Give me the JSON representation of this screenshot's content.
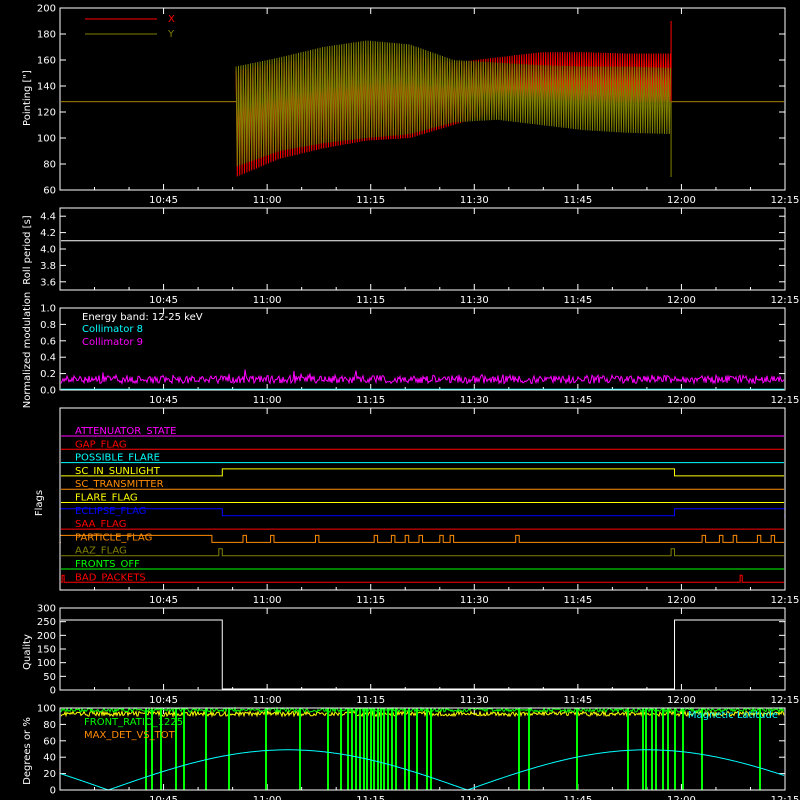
{
  "time_axis": {
    "ticks": [
      "10:45",
      "11:00",
      "11:15",
      "11:30",
      "11:45",
      "12:00",
      "12:15"
    ],
    "range_minutes": [
      630,
      735
    ],
    "tick_minutes": [
      645,
      660,
      675,
      690,
      705,
      720,
      735
    ]
  },
  "chart_data": [
    {
      "type": "line",
      "ylabel": "Pointing [\"]",
      "ylim": [
        60,
        200
      ],
      "yticks": [
        "60",
        "80",
        "100",
        "120",
        "140",
        "160",
        "180",
        "200"
      ],
      "legend_position": "top-left",
      "series": [
        {
          "name": "X",
          "color": "#ff0000",
          "baseline": 128,
          "active_start_min": 655.5,
          "active_end_min": 718.5,
          "envelope_min": [
            70,
            84,
            92,
            98,
            100,
            110,
            120,
            125,
            127,
            127,
            128
          ],
          "envelope_max": [
            152,
            158,
            162,
            165,
            164,
            158,
            162,
            166,
            166,
            165,
            165
          ]
        },
        {
          "name": "Y",
          "color": "#808000",
          "baseline": 128,
          "active_start_min": 655.5,
          "active_end_min": 718.5,
          "envelope_min": [
            78,
            90,
            96,
            100,
            103,
            112,
            114,
            110,
            106,
            104,
            103
          ],
          "envelope_max": [
            155,
            162,
            170,
            175,
            172,
            160,
            158,
            156,
            155,
            155,
            154
          ]
        }
      ]
    },
    {
      "type": "line",
      "ylabel": "Roll period [s]",
      "ylim": [
        3.5,
        4.5
      ],
      "yticks": [
        "3.6",
        "3.8",
        "4.0",
        "4.2",
        "4.4"
      ],
      "series": [
        {
          "name": "",
          "color": "#ffffff",
          "value": 4.1
        }
      ]
    },
    {
      "type": "line",
      "ylabel": "Normalized modulation",
      "ylim": [
        0.0,
        1.0
      ],
      "yticks": [
        "0.0",
        "0.2",
        "0.4",
        "0.6",
        "0.8",
        "1.0"
      ],
      "annotations": [
        "Energy band: 12-25 keV"
      ],
      "series": [
        {
          "name": "Collimator 8",
          "color": "#00ffff",
          "mean": 0.01,
          "noise": 0.0
        },
        {
          "name": "Collimator 9",
          "color": "#ff00ff",
          "mean": 0.13,
          "noise": 0.05
        }
      ]
    },
    {
      "type": "line",
      "ylabel": "Flags",
      "flags": [
        {
          "name": "ATTENUATOR_STATE",
          "color": "#ff00ff",
          "segments": []
        },
        {
          "name": "GAP_FLAG",
          "color": "#ff0000",
          "segments": []
        },
        {
          "name": "POSSIBLE_FLARE",
          "color": "#00ffff",
          "segments": []
        },
        {
          "name": "SC_IN_SUNLIGHT",
          "color": "#ffff00",
          "segments": [
            [
              653.5,
              719
            ]
          ]
        },
        {
          "name": "SC_TRANSMITTER",
          "color": "#ff8c00",
          "segments": []
        },
        {
          "name": "FLARE_FLAG",
          "color": "#ffff00",
          "segments": []
        },
        {
          "name": "ECLIPSE_FLAG",
          "color": "#0000ff",
          "segments": [
            [
              630,
              653.5
            ],
            [
              719,
              735
            ]
          ]
        },
        {
          "name": "SAA_FLAG",
          "color": "#ff0000",
          "segments": []
        },
        {
          "name": "PARTICLE_FLAG",
          "color": "#ff8c00",
          "segments": [
            [
              630,
              652
            ],
            [
              656.5,
              657
            ],
            [
              660.5,
              661
            ],
            [
              667,
              667.5
            ],
            [
              675.5,
              676
            ],
            [
              678,
              678.5
            ],
            [
              680,
              680.5
            ],
            [
              682,
              682.5
            ],
            [
              685,
              685.5
            ],
            [
              686.5,
              687
            ],
            [
              696,
              696.5
            ],
            [
              723,
              723.5
            ],
            [
              725.5,
              726
            ],
            [
              727.5,
              728
            ],
            [
              731,
              731.5
            ],
            [
              733,
              733.5
            ]
          ]
        },
        {
          "name": "AAZ_FLAG",
          "color": "#808000",
          "segments": [
            [
              653,
              653.5
            ],
            [
              718.5,
              719
            ]
          ]
        },
        {
          "name": "FRONTS_OFF",
          "color": "#00ff00",
          "segments": []
        },
        {
          "name": "BAD_PACKETS",
          "color": "#ff0000",
          "segments": [
            [
              630.3,
              630.6
            ],
            [
              728.5,
              728.8
            ]
          ]
        }
      ]
    },
    {
      "type": "line",
      "ylabel": "Quality",
      "ylim": [
        0,
        300
      ],
      "yticks": [
        "0",
        "50",
        "100",
        "150",
        "200",
        "250",
        "300"
      ],
      "series": [
        {
          "name": "",
          "color": "#ffffff",
          "high": 256,
          "low": 0,
          "low_start_min": 653.5,
          "low_end_min": 719
        }
      ]
    },
    {
      "type": "line",
      "ylabel": "Degrees or %",
      "ylim": [
        0,
        100
      ],
      "yticks": [
        "0",
        "20",
        "40",
        "60",
        "80",
        "100"
      ],
      "series": [
        {
          "name": "FRONT_RATIO_1225",
          "color": "#00ff00",
          "label_color": "#00ff00"
        },
        {
          "name": "MAX_DET_VS_TOT",
          "color": "#ffff00",
          "label_color": "#ff8c00"
        },
        {
          "name": "Magnetic Latitude",
          "color": "#00ffff",
          "label_color": "#00ffff",
          "peak": 49,
          "period_min": 52,
          "zero_min": 637
        }
      ]
    }
  ]
}
